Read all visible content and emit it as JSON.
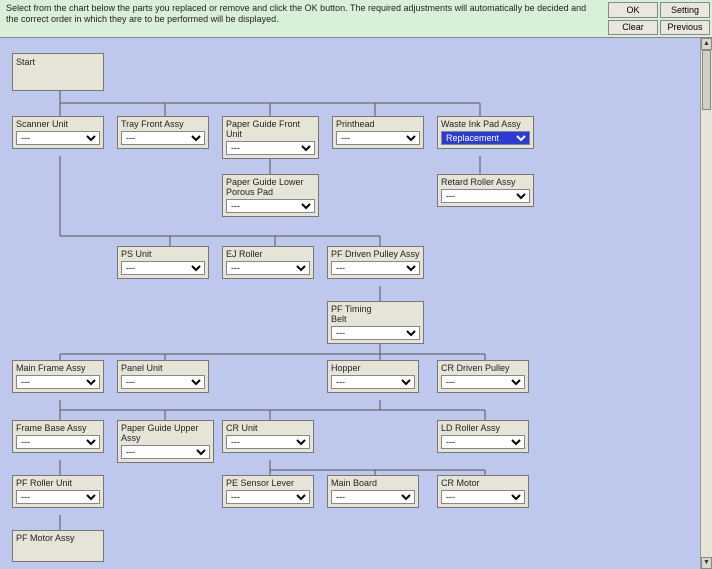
{
  "instruction": "Select from the chart below the parts you replaced or remove and click the OK button. The required adjustments will automatically be decided and the correct order in which they are to be performed will be displayed.",
  "buttons": {
    "ok": "OK",
    "setting": "Setting",
    "clear": "Clear",
    "previous": "Previous"
  },
  "dropdown": {
    "default": "---",
    "replacement": "Replacement"
  },
  "nodes": {
    "start": "Start",
    "scanner_unit": "Scanner Unit",
    "tray_front_assy": "Tray Front Assy",
    "paper_guide_front": "Paper Guide Front Unit",
    "printhead": "Printhead",
    "waste_ink_pad": "Waste Ink Pad Assy",
    "paper_guide_lower": "Paper Guide Lower\nPorous Pad",
    "retard_roller": "Retard Roller Assy",
    "ps_unit": "PS Unit",
    "ej_roller": "EJ Roller",
    "pf_driven_pulley": "PF Driven Pulley Assy",
    "pf_timing_belt": "PF Timing\nBelt",
    "main_frame": "Main Frame Assy",
    "panel_unit": "Panel Unit",
    "hopper": "Hopper",
    "cr_driven_pulley": "CR Driven Pulley",
    "frame_base": "Frame Base Assy",
    "paper_guide_upper": "Paper Guide Upper\nAssy",
    "cr_unit": "CR Unit",
    "ld_roller": "LD Roller Assy",
    "pf_roller_unit": "PF Roller Unit",
    "pe_sensor_lever": "PE Sensor Lever",
    "main_board": "Main Board",
    "cr_motor": "CR Motor",
    "pf_motor": "PF Motor Assy"
  }
}
